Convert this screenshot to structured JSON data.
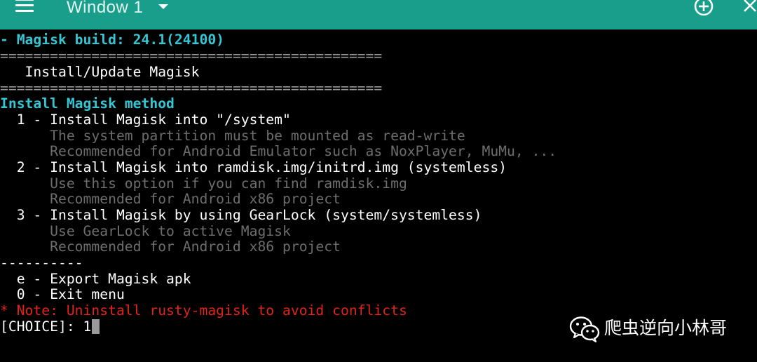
{
  "window": {
    "title": "Window 1"
  },
  "icons": {
    "menu": "hamburger-menu-icon",
    "dropdown": "chevron-down-icon",
    "add": "plus-circle-icon",
    "close": "close-icon"
  },
  "colors": {
    "titlebar": "#1a9e8c",
    "background": "#000000",
    "heading": "#36c5d2",
    "hint": "#6d6d6d",
    "note": "#e2231a"
  },
  "terminal": {
    "build_line": "- Magisk build: 24.1(24100)",
    "separator": "==============================================",
    "menu_title": "   Install/Update Magisk",
    "method_heading": "Install Magisk method",
    "option1_label": "  1 - Install Magisk into \"/system\"",
    "option1_hint1": "      The system partition must be mounted as read-write",
    "option1_hint2": "      Recommended for Android Emulator such as NoxPlayer, MuMu, ...",
    "option2_label": "  2 - Install Magisk into ramdisk.img/initrd.img (systemless)",
    "option2_hint1": "      Use this option if you can find ramdisk.img",
    "option2_hint2": "      Recommended for Android x86 project",
    "option3_label": "  3 - Install Magisk by using GearLock (system/systemless)",
    "option3_hint1": "      Use GearLock to active Magisk",
    "option3_hint2": "      Recommended for Android x86 project",
    "short_separator": "----------",
    "export_option": "  e - Export Magisk apk",
    "exit_option": "  0 - Exit menu",
    "note": "* Note: Uninstall rusty-magisk to avoid conflicts",
    "prompt": "[CHOICE]: ",
    "input_value": "1"
  },
  "watermark": {
    "logo": "wechat-logo-icon",
    "text": "爬虫逆向小林哥"
  }
}
